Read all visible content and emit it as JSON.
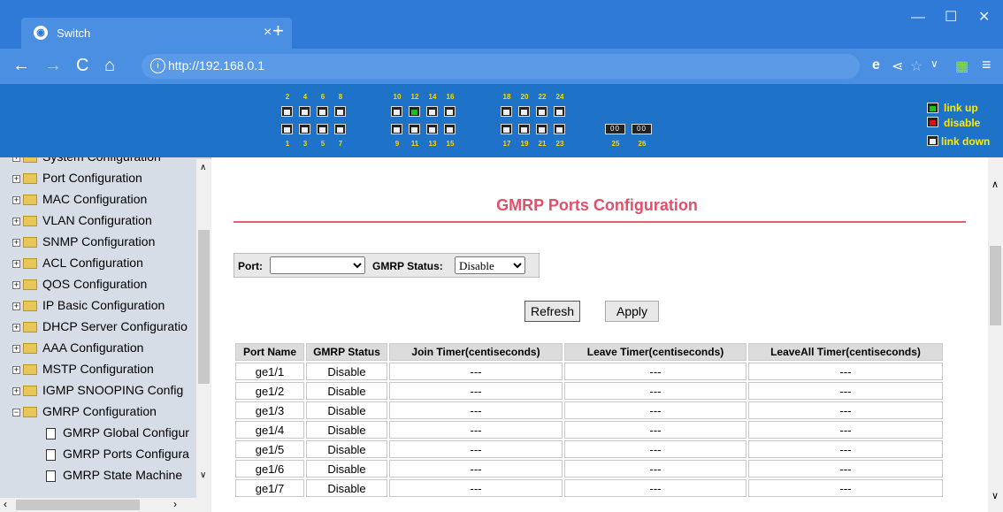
{
  "browser": {
    "tab_title": "Switch",
    "tab_close": "×",
    "new_tab": "+",
    "url": "http://192.168.0.1"
  },
  "banner": {
    "top_labels": [
      "2",
      "4",
      "6",
      "8",
      "10",
      "12",
      "14",
      "16",
      "18",
      "20",
      "22",
      "24"
    ],
    "bottom_labels": [
      "1",
      "3",
      "5",
      "7",
      "9",
      "11",
      "13",
      "15",
      "17",
      "19",
      "21",
      "23",
      "25",
      "26"
    ],
    "port_up": "12",
    "legend": [
      "link up",
      "disable",
      "link down"
    ]
  },
  "tree": {
    "items": [
      "System Configuration",
      "Port Configuration",
      "MAC Configuration",
      "VLAN Configuration",
      "SNMP Configuration",
      "ACL Configuration",
      "QOS Configuration",
      "IP Basic Configuration",
      "DHCP Server Configuratio",
      "AAA Configuration",
      "MSTP Configuration",
      "IGMP SNOOPING Config",
      "GMRP Configuration"
    ],
    "children": [
      "GMRP Global Configur",
      "GMRP Ports Configura",
      "GMRP State Machine"
    ]
  },
  "main": {
    "title": "GMRP Ports Configuration",
    "port_label": "Port:",
    "port_value": "",
    "gmrp_status_label": "GMRP Status:",
    "gmrp_status_value": "Disable",
    "refresh_label": "Refresh",
    "apply_label": "Apply",
    "columns": [
      "Port Name",
      "GMRP Status",
      "Join Timer(centiseconds)",
      "Leave Timer(centiseconds)",
      "LeaveAll Timer(centiseconds)"
    ],
    "rows": [
      [
        "ge1/1",
        "Disable",
        "---",
        "---",
        "---"
      ],
      [
        "ge1/2",
        "Disable",
        "---",
        "---",
        "---"
      ],
      [
        "ge1/3",
        "Disable",
        "---",
        "---",
        "---"
      ],
      [
        "ge1/4",
        "Disable",
        "---",
        "---",
        "---"
      ],
      [
        "ge1/5",
        "Disable",
        "---",
        "---",
        "---"
      ],
      [
        "ge1/6",
        "Disable",
        "---",
        "---",
        "---"
      ],
      [
        "ge1/7",
        "Disable",
        "---",
        "---",
        "---"
      ]
    ]
  }
}
